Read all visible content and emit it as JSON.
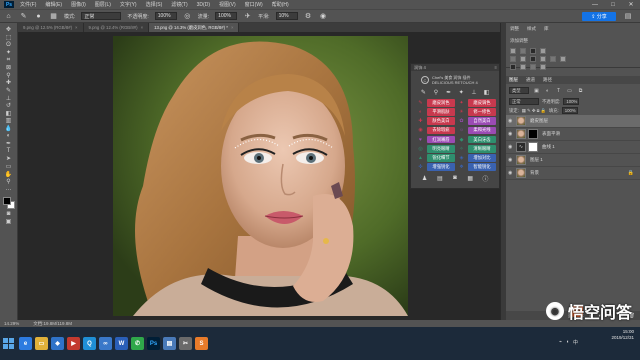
{
  "menubar": {
    "logo": "Ps",
    "items": [
      "文件(F)",
      "编辑(E)",
      "图像(I)",
      "图层(L)",
      "文字(Y)",
      "选择(S)",
      "滤镜(T)",
      "3D(D)",
      "视图(V)",
      "窗口(W)",
      "帮助(H)"
    ],
    "window_controls": [
      "—",
      "□",
      "✕"
    ]
  },
  "options": {
    "mode_label": "模式:",
    "mode_value": "正常",
    "opacity_label": "不透明度:",
    "opacity_value": "100%",
    "flow_label": "流量:",
    "flow_value": "100%",
    "smooth_label": "平滑:",
    "smooth_value": "10%",
    "share_label": "⇪ 分享"
  },
  "tabs": [
    {
      "label": "9.png @ 12.5% (RGB/8#)",
      "active": false
    },
    {
      "label": "9.png @ 12.4% (RGB/8#)",
      "active": false
    },
    {
      "label": "13.png @ 14.3% (磨皮润色, RGB/8#) *",
      "active": true
    }
  ],
  "retouch": {
    "header": "润饰 4",
    "brand_line1": "Chef's 美食 润饰 插件",
    "brand_line2": "DELICIOUS RETOUCH 4",
    "buttons": [
      {
        "label": "磨皮润色",
        "color": "#c8394e"
      },
      {
        "label": "磨皮调色",
        "color": "#c8394e"
      },
      {
        "label": "平滑肌肤",
        "color": "#c8394e"
      },
      {
        "label": "修一修色",
        "color": "#c8394e"
      },
      {
        "label": "肤色美白",
        "color": "#c8394e"
      },
      {
        "label": "自然美白",
        "color": "#9b4bb4"
      },
      {
        "label": "去除瑕疵",
        "color": "#c8394e"
      },
      {
        "label": "柔和光线",
        "color": "#9b4bb4"
      },
      {
        "label": "红润嘴唇",
        "color": "#9b4bb4"
      },
      {
        "label": "美白牙齿",
        "color": "#2f8f6e"
      },
      {
        "label": "明亮眼睛",
        "color": "#2f8f6e"
      },
      {
        "label": "清晰眼睛",
        "color": "#2f8f6e"
      },
      {
        "label": "锐化细节",
        "color": "#2f8f6e"
      },
      {
        "label": "增加对比",
        "color": "#3a62b0"
      },
      {
        "label": "增强锐化",
        "color": "#3a62b0"
      },
      {
        "label": "智能锐化",
        "color": "#3a62b0"
      }
    ]
  },
  "library": {
    "tabs": [
      "调整",
      "样式",
      "库"
    ],
    "label": "添加调整"
  },
  "layers": {
    "tabs": [
      "图层",
      "通道",
      "路径"
    ],
    "kind": "类型",
    "blend": "正常",
    "opacity_label": "不透明度:",
    "opacity": "100%",
    "lock_label": "锁定:",
    "fill_label": "填充:",
    "fill": "100%",
    "items": [
      {
        "name": "磨皮图层",
        "thumb": "face",
        "selected": true
      },
      {
        "name": "表面平滑",
        "thumb": "face-mask",
        "selected": false
      },
      {
        "name": "曲线 1",
        "thumb": "adj",
        "selected": false
      },
      {
        "name": "图层 1",
        "thumb": "face",
        "selected": false
      },
      {
        "name": "背景",
        "thumb": "face",
        "selected": false,
        "locked": true
      }
    ]
  },
  "status": {
    "zoom": "14.29%",
    "doc": "文档:19.8M/119.8M"
  },
  "tray": {
    "time": "15:00",
    "date": "2019/12/31"
  },
  "watermark": {
    "text": "悟空问答"
  }
}
